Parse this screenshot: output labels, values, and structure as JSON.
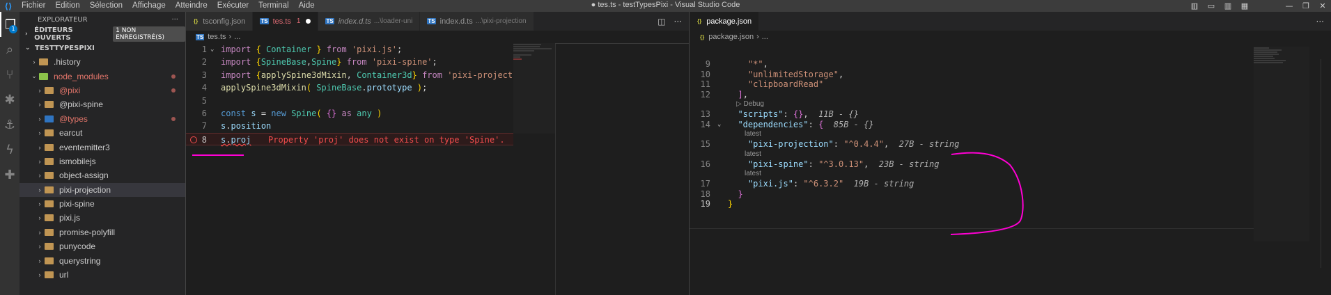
{
  "window": {
    "title": "● tes.ts - testTypesPixi - Visual Studio Code",
    "menu": [
      "Fichier",
      "Edition",
      "Sélection",
      "Affichage",
      "Atteindre",
      "Exécuter",
      "Terminal",
      "Aide"
    ]
  },
  "activity": {
    "explorer_badge": "1"
  },
  "explorer": {
    "title": "EXPLORATEUR",
    "more": "···",
    "open_editors": "ÉDITEURS OUVERTS",
    "unsaved_badge": "1 NON ENREGISTRÉ(S)",
    "workspace": "TESTTYPESPIXI",
    "items": [
      {
        "label": ".history",
        "depth": 1,
        "chev": "›",
        "icon": "folder",
        "modified": false,
        "dot": false
      },
      {
        "label": "node_modules",
        "depth": 1,
        "chev": "⌄",
        "icon": "nm",
        "modified": true,
        "dot": true
      },
      {
        "label": "@pixi",
        "depth": 2,
        "chev": "›",
        "icon": "folder",
        "modified": true,
        "dot": true
      },
      {
        "label": "@pixi-spine",
        "depth": 2,
        "chev": "›",
        "icon": "folder",
        "modified": false,
        "dot": false
      },
      {
        "label": "@types",
        "depth": 2,
        "chev": "›",
        "icon": "ts",
        "modified": true,
        "dot": true
      },
      {
        "label": "earcut",
        "depth": 2,
        "chev": "›",
        "icon": "folder",
        "modified": false,
        "dot": false
      },
      {
        "label": "eventemitter3",
        "depth": 2,
        "chev": "›",
        "icon": "folder",
        "modified": false,
        "dot": false
      },
      {
        "label": "ismobilejs",
        "depth": 2,
        "chev": "›",
        "icon": "folder",
        "modified": false,
        "dot": false
      },
      {
        "label": "object-assign",
        "depth": 2,
        "chev": "›",
        "icon": "folder",
        "modified": false,
        "dot": false
      },
      {
        "label": "pixi-projection",
        "depth": 2,
        "chev": "›",
        "icon": "folder",
        "modified": false,
        "dot": false,
        "selected": true
      },
      {
        "label": "pixi-spine",
        "depth": 2,
        "chev": "›",
        "icon": "folder",
        "modified": false,
        "dot": false
      },
      {
        "label": "pixi.js",
        "depth": 2,
        "chev": "›",
        "icon": "folder",
        "modified": false,
        "dot": false
      },
      {
        "label": "promise-polyfill",
        "depth": 2,
        "chev": "›",
        "icon": "folder",
        "modified": false,
        "dot": false
      },
      {
        "label": "punycode",
        "depth": 2,
        "chev": "›",
        "icon": "folder",
        "modified": false,
        "dot": false
      },
      {
        "label": "querystring",
        "depth": 2,
        "chev": "›",
        "icon": "folder",
        "modified": false,
        "dot": false
      },
      {
        "label": "url",
        "depth": 2,
        "chev": "›",
        "icon": "folder",
        "modified": false,
        "dot": false
      }
    ]
  },
  "editor1": {
    "tabs": [
      {
        "label": "tsconfig.json",
        "icon": "{}",
        "kind": "json",
        "active": false,
        "italic": false,
        "desc": "",
        "mods": "",
        "dirty": false
      },
      {
        "label": "tes.ts",
        "icon": "TS",
        "kind": "ts",
        "active": true,
        "italic": false,
        "desc": "",
        "mods": "1",
        "dirty": true
      },
      {
        "label": "index.d.ts",
        "icon": "TS",
        "kind": "ts",
        "active": false,
        "italic": true,
        "desc": "...\\loader-uni",
        "mods": "",
        "dirty": false
      },
      {
        "label": "index.d.ts",
        "icon": "TS",
        "kind": "ts",
        "active": false,
        "italic": false,
        "desc": "...\\pixi-projection",
        "mods": "",
        "dirty": false
      }
    ],
    "breadcrumb": {
      "file": "tes.ts",
      "rest": "..."
    },
    "lines": [
      {
        "n": "1",
        "fold": "⌄",
        "tokens": [
          [
            "k",
            "import"
          ],
          [
            "p",
            " "
          ],
          [
            "b1",
            "{"
          ],
          [
            "p",
            " "
          ],
          [
            "t",
            "Container"
          ],
          [
            "p",
            " "
          ],
          [
            "b1",
            "}"
          ],
          [
            "p",
            " "
          ],
          [
            "k",
            "from"
          ],
          [
            "p",
            " "
          ],
          [
            "s",
            "'pixi.js'"
          ],
          [
            "p",
            ";"
          ]
        ]
      },
      {
        "n": "2",
        "tokens": [
          [
            "k",
            "import"
          ],
          [
            "p",
            " "
          ],
          [
            "b1",
            "{"
          ],
          [
            "t",
            "SpineBase"
          ],
          [
            "p",
            ","
          ],
          [
            "t",
            "Spine"
          ],
          [
            "b1",
            "}"
          ],
          [
            "p",
            " "
          ],
          [
            "k",
            "from"
          ],
          [
            "p",
            " "
          ],
          [
            "s",
            "'pixi-spine'"
          ],
          [
            "p",
            ";"
          ]
        ]
      },
      {
        "n": "3",
        "tokens": [
          [
            "k",
            "import"
          ],
          [
            "p",
            " "
          ],
          [
            "b1",
            "{"
          ],
          [
            "f",
            "applySpine3dMixin"
          ],
          [
            "p",
            ", "
          ],
          [
            "t",
            "Container3d"
          ],
          [
            "b1",
            "}"
          ],
          [
            "p",
            " "
          ],
          [
            "k",
            "from"
          ],
          [
            "p",
            " "
          ],
          [
            "s",
            "'pixi-projection'"
          ],
          [
            "p",
            ";"
          ]
        ]
      },
      {
        "n": "4",
        "tokens": [
          [
            "f",
            "applySpine3dMixin"
          ],
          [
            "b1",
            "("
          ],
          [
            "p",
            " "
          ],
          [
            "t",
            "SpineBase"
          ],
          [
            "p",
            "."
          ],
          [
            "v",
            "prototype"
          ],
          [
            "p",
            " "
          ],
          [
            "b1",
            ")"
          ],
          [
            "p",
            ";"
          ]
        ]
      },
      {
        "n": "5",
        "tokens": []
      },
      {
        "n": "6",
        "tokens": [
          [
            "kb",
            "const"
          ],
          [
            "p",
            " "
          ],
          [
            "v",
            "s"
          ],
          [
            "p",
            " = "
          ],
          [
            "kb",
            "new"
          ],
          [
            "p",
            " "
          ],
          [
            "t",
            "Spine"
          ],
          [
            "b1",
            "("
          ],
          [
            "p",
            " "
          ],
          [
            "b2",
            "{}"
          ],
          [
            "p",
            " "
          ],
          [
            "k",
            "as"
          ],
          [
            "p",
            " "
          ],
          [
            "t",
            "any"
          ],
          [
            "p",
            " "
          ],
          [
            "b1",
            ")"
          ]
        ]
      },
      {
        "n": "7",
        "tokens": [
          [
            "v",
            "s"
          ],
          [
            "p",
            "."
          ],
          [
            "v",
            "position"
          ]
        ]
      },
      {
        "n": "8",
        "cur": true,
        "error": true,
        "tokens": [
          [
            "v",
            "s"
          ],
          [
            "p",
            "."
          ],
          [
            "v",
            "proj"
          ]
        ],
        "message": "Property 'proj' does not exist on type 'Spine'."
      }
    ]
  },
  "editor2": {
    "tabs": [
      {
        "label": "package.json",
        "icon": "{}",
        "kind": "json",
        "active": true,
        "italic": false,
        "desc": "",
        "mods": "",
        "dirty": false
      }
    ],
    "breadcrumb": {
      "file": "package.json",
      "rest": "..."
    },
    "rows": [
      {
        "type": "code",
        "n": "9",
        "tokens": [
          [
            "p",
            "    "
          ],
          [
            "s",
            "\"*\""
          ],
          [
            "p",
            ","
          ]
        ]
      },
      {
        "type": "code",
        "n": "10",
        "tokens": [
          [
            "p",
            "    "
          ],
          [
            "s",
            "\"unlimitedStorage\""
          ],
          [
            "p",
            ","
          ]
        ]
      },
      {
        "type": "code",
        "n": "11",
        "tokens": [
          [
            "p",
            "    "
          ],
          [
            "s",
            "\"clipboardRead\""
          ]
        ]
      },
      {
        "type": "code",
        "n": "12",
        "tokens": [
          [
            "p",
            "  "
          ],
          [
            "b2",
            "]"
          ],
          [
            "p",
            ","
          ]
        ]
      },
      {
        "type": "lens",
        "indent": 12,
        "text": "▷ Debug"
      },
      {
        "type": "code",
        "n": "13",
        "tokens": [
          [
            "p",
            "  "
          ],
          [
            "v",
            "\"scripts\""
          ],
          [
            "p",
            ": "
          ],
          [
            "b2",
            "{}"
          ],
          [
            "p",
            ",  "
          ],
          [
            "hint",
            "11B - {}"
          ]
        ]
      },
      {
        "type": "code",
        "n": "14",
        "fold": "⌄",
        "tokens": [
          [
            "p",
            "  "
          ],
          [
            "v",
            "\"dependencies\""
          ],
          [
            "p",
            ": "
          ],
          [
            "b2",
            "{"
          ],
          [
            "p",
            "  "
          ],
          [
            "hint",
            "85B - {}"
          ]
        ]
      },
      {
        "type": "lens",
        "indent": 24,
        "text": "latest"
      },
      {
        "type": "code",
        "n": "15",
        "tokens": [
          [
            "p",
            "    "
          ],
          [
            "v",
            "\"pixi-projection\""
          ],
          [
            "p",
            ": "
          ],
          [
            "s",
            "\"^0.4.4\""
          ],
          [
            "p",
            ",  "
          ],
          [
            "hint",
            "27B - string"
          ]
        ]
      },
      {
        "type": "lens",
        "indent": 24,
        "text": "latest"
      },
      {
        "type": "code",
        "n": "16",
        "tokens": [
          [
            "p",
            "    "
          ],
          [
            "v",
            "\"pixi-spine\""
          ],
          [
            "p",
            ": "
          ],
          [
            "s",
            "\"^3.0.13\""
          ],
          [
            "p",
            ",  "
          ],
          [
            "hint",
            "23B - string"
          ]
        ]
      },
      {
        "type": "lens",
        "indent": 24,
        "text": "latest"
      },
      {
        "type": "code",
        "n": "17",
        "tokens": [
          [
            "p",
            "    "
          ],
          [
            "v",
            "\"pixi.js\""
          ],
          [
            "p",
            ": "
          ],
          [
            "s",
            "\"^6.3.2\""
          ],
          [
            "p",
            "  "
          ],
          [
            "hint",
            "19B - string"
          ]
        ]
      },
      {
        "type": "code",
        "n": "18",
        "tokens": [
          [
            "p",
            "  "
          ],
          [
            "b2",
            "}"
          ]
        ]
      },
      {
        "type": "code",
        "n": "19",
        "cur": true,
        "tokens": [
          [
            "b1",
            "}"
          ]
        ]
      }
    ]
  },
  "colors": {
    "accent": "#007acc",
    "error": "#f14c4c",
    "annotation": "#ff00d4"
  }
}
